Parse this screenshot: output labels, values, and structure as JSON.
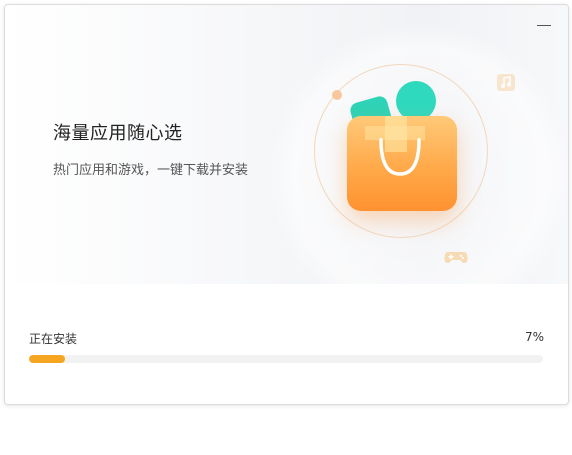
{
  "banner": {
    "headline": "海量应用随心选",
    "subline": "热门应用和游戏，一键下载并安装"
  },
  "window_controls": {
    "minimize_icon": "minimize-icon"
  },
  "illustration": {
    "icons": [
      "shopping-bag-icon",
      "music-note-icon",
      "gamepad-icon"
    ]
  },
  "install": {
    "status_label": "正在安装",
    "progress_text": "7%",
    "progress_fraction": 0.07
  },
  "colors": {
    "accent": "#f5a51f",
    "bag_top": "#ffc978",
    "bag_bottom": "#ff9230",
    "teal": "#2fd3b7",
    "track": "#f2f2f2"
  }
}
